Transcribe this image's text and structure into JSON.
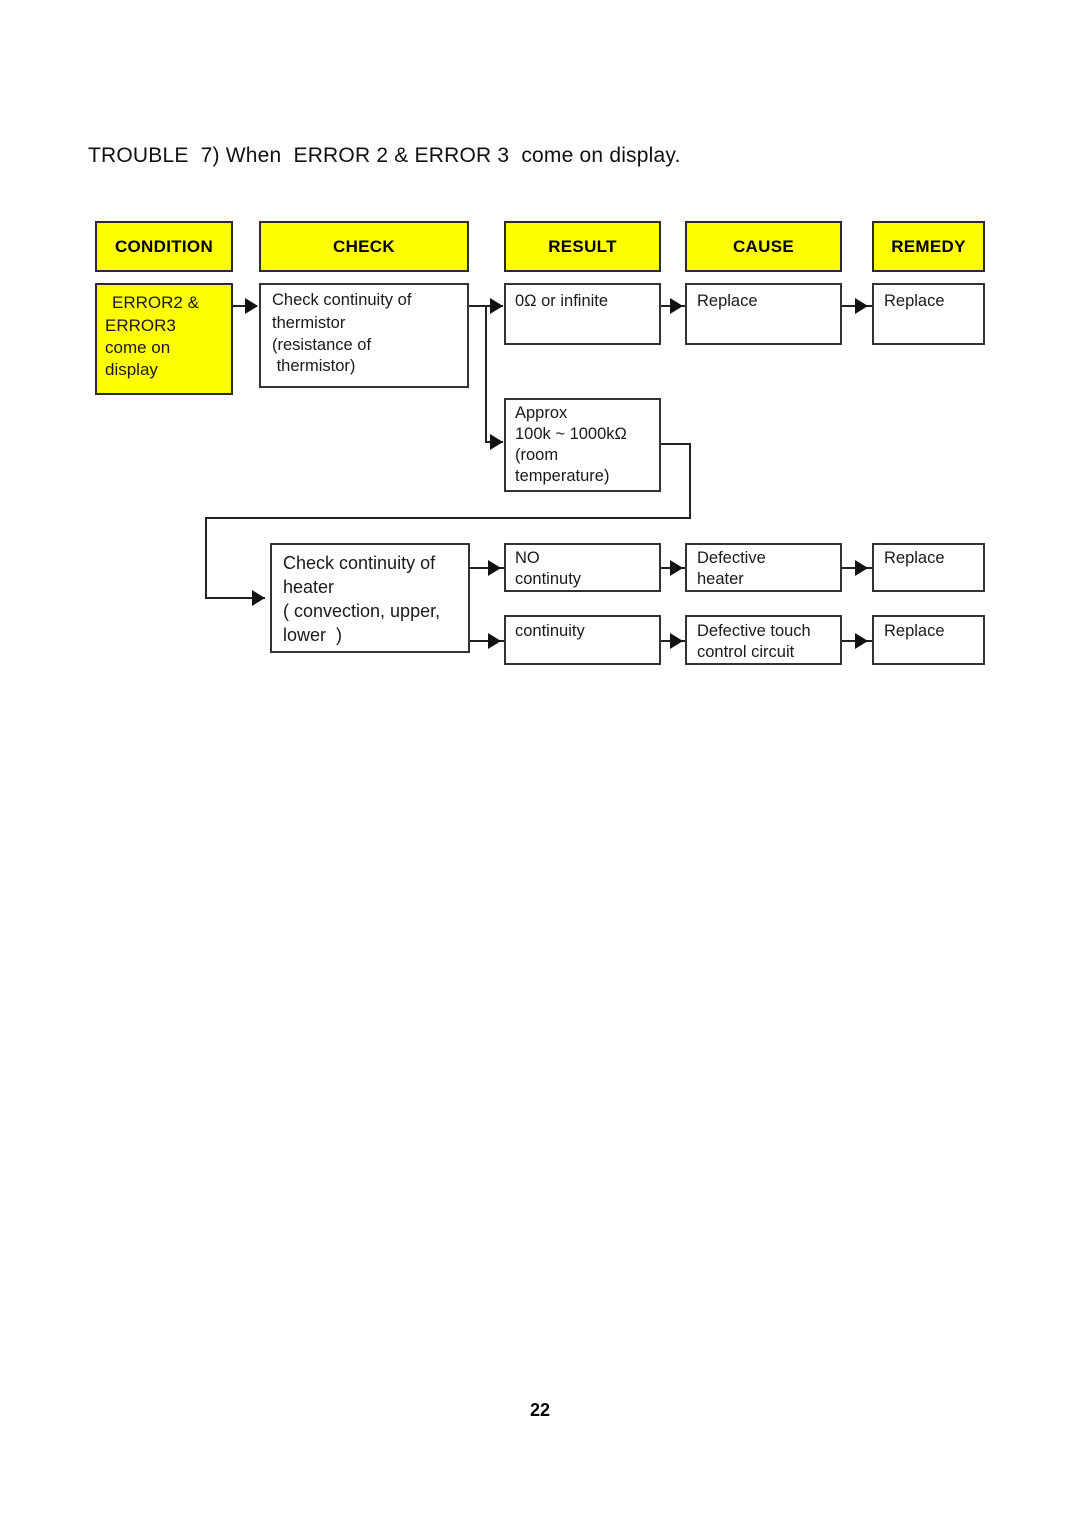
{
  "document": {
    "title": "TROUBLE  7) When  ERROR 2 & ERROR 3  come on display.",
    "page_number": "22"
  },
  "colors": {
    "header_fill": "#ffff00",
    "condition_fill": "#ffff00",
    "box_border": "#333333",
    "text": "#1a1a1a",
    "background": "#ffffff"
  },
  "headers": [
    {
      "label": "CONDITION"
    },
    {
      "label": "CHECK"
    },
    {
      "label": "RESULT"
    },
    {
      "label": "CAUSE"
    },
    {
      "label": "REMEDY"
    }
  ],
  "condition": {
    "line1": "ERROR2 &",
    "line2": "ERROR3",
    "line3": "come on",
    "line4": "display"
  },
  "checks": {
    "thermistor": {
      "line1": "Check continuity of",
      "line2": "thermistor",
      "line3": "(resistance of",
      "line4": " thermistor)"
    },
    "heater": {
      "line1": "Check continuity of",
      "line2": "heater",
      "line3": "( convection, upper,",
      "line4": "lower  )"
    }
  },
  "results": {
    "zero_or_infinite": {
      "line1": "0Ω or infinite"
    },
    "approx": {
      "line1": "Approx",
      "line2": "100k ~ 1000kΩ",
      "line3": "(room",
      "line4": "temperature)"
    },
    "no_continuity": {
      "line1": "NO",
      "line2": "continuty"
    },
    "continuity": {
      "line1": "continuity"
    }
  },
  "causes": {
    "replace_thermistor": {
      "line1": "Replace"
    },
    "defective_heater": {
      "line1": "Defective",
      "line2": "heater"
    },
    "defective_touch": {
      "line1": "Defective touch",
      "line2": "control circuit"
    }
  },
  "remedies": {
    "replace_1": {
      "line1": "Replace"
    },
    "replace_2": {
      "line1": "Replace"
    },
    "replace_3": {
      "line1": "Replace"
    }
  }
}
